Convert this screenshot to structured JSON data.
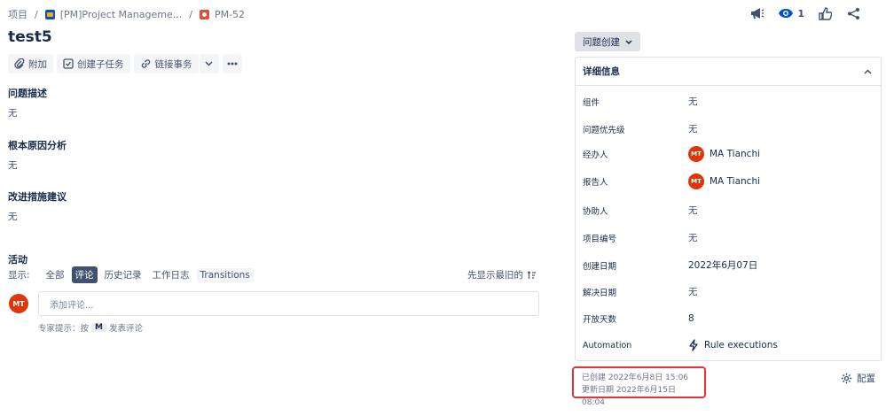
{
  "breadcrumb": {
    "root": "项目",
    "project": "[PM]Project Manageme...",
    "issue_key": "PM-52"
  },
  "header": {
    "watch_count": "1"
  },
  "issue": {
    "title": "test5"
  },
  "toolbar": {
    "attach_label": "附加",
    "subtask_label": "创建子任务",
    "link_label": "链接事务"
  },
  "sections": [
    {
      "title": "问题描述",
      "value": "无"
    },
    {
      "title": "根本原因分析",
      "value": "无"
    },
    {
      "title": "改进措施建议",
      "value": "无"
    }
  ],
  "activity": {
    "title": "活动",
    "show_label": "显示:",
    "filters": [
      "全部",
      "评论",
      "历史记录",
      "工作日志",
      "Transitions"
    ],
    "active_filter": "评论",
    "sort_label": "先显示最旧的",
    "comment_placeholder": "添加评论...",
    "hint_prefix": "专家提示：按",
    "hint_key": "M",
    "hint_suffix": "发表评论",
    "avatar_initials": "MT"
  },
  "status": {
    "label": "问题创建"
  },
  "details": {
    "title": "详细信息",
    "rows": [
      {
        "key": "组件",
        "value": "无"
      },
      {
        "key": "问题优先级",
        "value": "无"
      },
      {
        "key": "经办人",
        "value": "MA Tianchi",
        "initials": "MT"
      },
      {
        "key": "报告人",
        "value": "MA Tianchi",
        "initials": "MT"
      },
      {
        "key": "协助人",
        "value": "无"
      },
      {
        "key": "项目编号",
        "value": "无"
      },
      {
        "key": "创建日期",
        "value": "2022年6月07日"
      },
      {
        "key": "解决日期",
        "value": "无"
      },
      {
        "key": "开放天数",
        "value": "8"
      },
      {
        "key": "Automation",
        "value": "Rule executions"
      }
    ]
  },
  "meta": {
    "created": "已创建 2022年6月8日 15:06",
    "updated": "更新日期 2022年6月15日 08:04"
  },
  "config_label": "配置",
  "colors": {
    "avatar": "#de350b",
    "highlight": "#e5333a",
    "active_filter": "#42526e"
  }
}
